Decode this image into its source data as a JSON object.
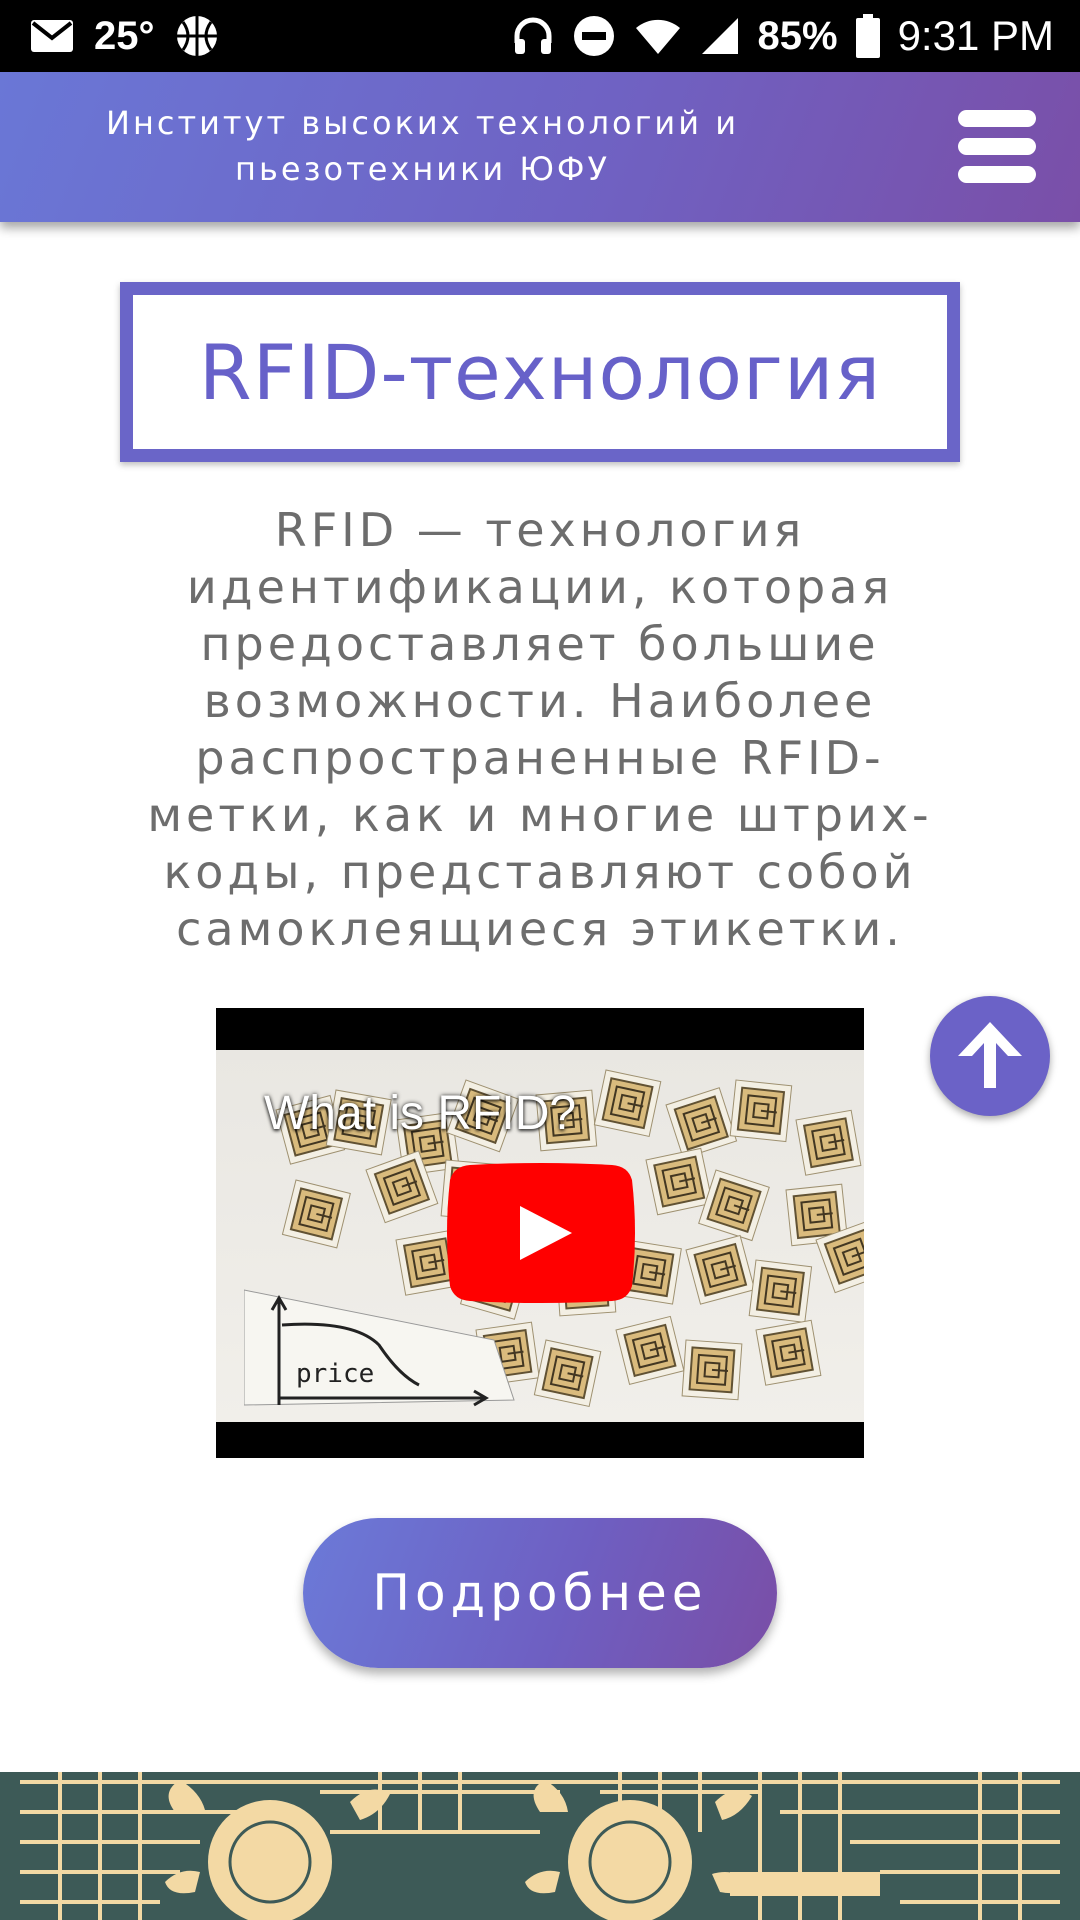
{
  "status_bar": {
    "temperature": "25°",
    "battery": "85%",
    "time": "9:31 PM",
    "icons": [
      "gmail-icon",
      "basketball-icon",
      "headphones-icon",
      "do-not-disturb-icon",
      "wifi-icon",
      "signal-icon",
      "battery-icon"
    ]
  },
  "header": {
    "title": "Институт высоких технологий и пьезотехники ЮФУ",
    "menu_icon": "hamburger-menu-icon"
  },
  "main": {
    "heading": "RFID-технология",
    "description": "RFID — технология идентификации, которая предоставляет большие возможности. Наиболее распространенные RFID-метки, как и многие штрих-коды, представляют собой самоклеящиеся этикетки.",
    "video": {
      "title": "What is RFID?",
      "chart_label": "price",
      "play_icon": "youtube-play-icon"
    },
    "more_button": "Подробнее",
    "scroll_top_icon": "arrow-up-icon"
  },
  "colors": {
    "accent": "#6761c9",
    "header_gradient_start": "#6a77d6",
    "header_gradient_end": "#7a4fa8",
    "text_gray": "#6d6d6d",
    "youtube_red": "#ff0000",
    "footer_teal": "#3d5a57",
    "footer_cream": "#f3d9a4"
  }
}
